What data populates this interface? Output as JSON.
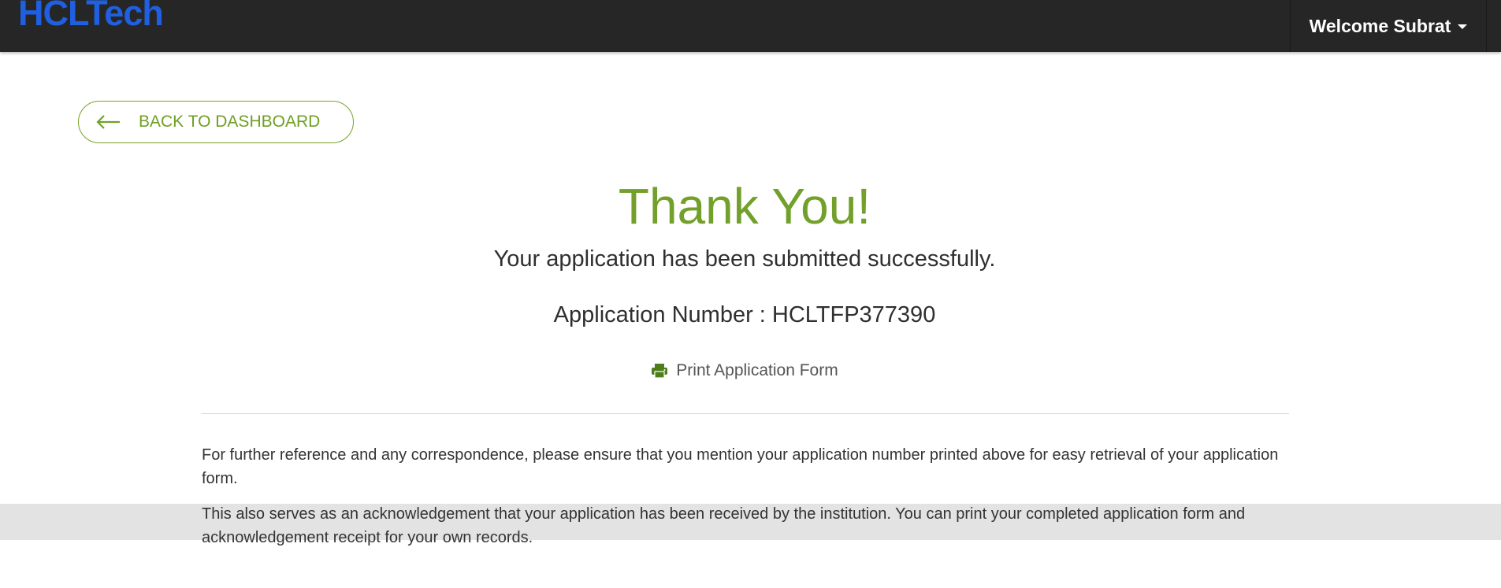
{
  "header": {
    "logo_text": "HCLTech",
    "user_menu_label": "Welcome Subrat",
    "background_color": "#262626",
    "logo_color": "#1f5fe0"
  },
  "back_button": {
    "label": "BACK TO DASHBOARD",
    "icon": "arrow-left-icon",
    "accent_color": "#72a02a"
  },
  "main": {
    "heading": "Thank You!",
    "message": "Your application has been submitted successfully.",
    "application_number_text": "Application Number : HCLTFP377390",
    "print_link": {
      "label": "Print Application Form",
      "icon": "printer-icon"
    },
    "paragraphs": [
      "For further reference and any correspondence, please ensure that you mention your application number printed above for easy retrieval of your application form.",
      "This also serves as an acknowledgement that your application has been received by the institution. You can print your completed application form and acknowledgement receipt for your own records."
    ]
  }
}
